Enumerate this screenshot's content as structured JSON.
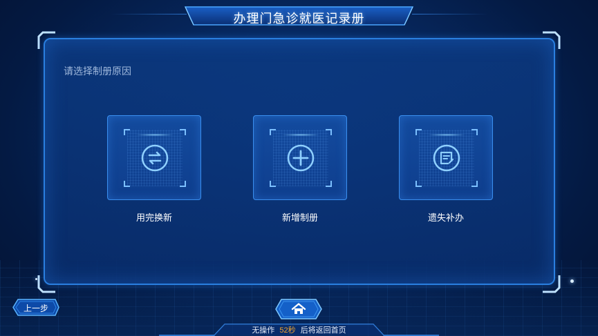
{
  "header": {
    "title": "办理门急诊就医记录册"
  },
  "panel": {
    "prompt": "请选择制册原因"
  },
  "options": [
    {
      "label": "用完换新",
      "icon": "exchange-icon"
    },
    {
      "label": "新增制册",
      "icon": "plus-circle-icon"
    },
    {
      "label": "遗失补办",
      "icon": "edit-document-icon"
    }
  ],
  "footer": {
    "back_label": "上一步",
    "home_icon": "home-icon",
    "timeout_prefix": "无操作",
    "timeout_seconds": "52秒",
    "timeout_suffix": "后将返回首页"
  },
  "colors": {
    "accent": "#2a7fe0",
    "highlight": "#f2a430",
    "background": "#041634"
  }
}
